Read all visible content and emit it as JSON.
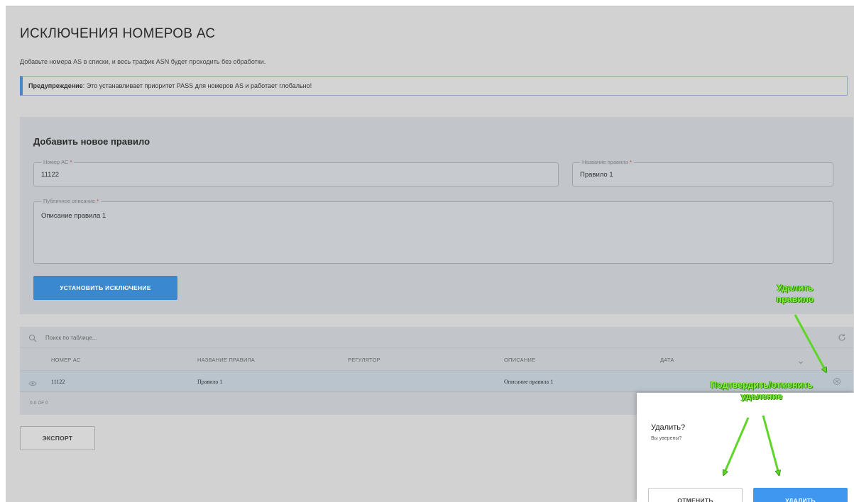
{
  "page": {
    "title": "ИСКЛЮЧЕНИЯ НОМЕРОВ АС",
    "subtitle": "Добавьте номера AS в списки, и весь трафик ASN будет проходить без обработки.",
    "warning_label": "Предупреждение",
    "warning_text": ": Это устанавливает приоритет PASS для номеров AS и работает глобально!"
  },
  "form": {
    "title": "Добавить новое правило",
    "as_number": {
      "label": "Номер АС",
      "value": "11122"
    },
    "rule_name": {
      "label": "Название правила",
      "value": "Правило 1"
    },
    "description": {
      "label": "Публичное описание",
      "value": "Описание правила 1"
    },
    "required_mark": "*",
    "submit_label": "УСТАНОВИТЬ ИСКЛЮЧЕНИЕ"
  },
  "table": {
    "search_placeholder": "Поиск по таблице...",
    "columns": [
      "НОМЕР АС",
      "НАЗВАНИЕ ПРАВИЛА",
      "РЕГУЛЯТОР",
      "ОПИСАНИЕ",
      "ДАТА"
    ],
    "rows": [
      {
        "as_number": "11122",
        "rule_name": "Правило 1",
        "regulator": "",
        "description": "Описание правила 1",
        "date": ""
      }
    ],
    "count_text": "0-0 OF 0"
  },
  "export_label": "ЭКСПОРТ",
  "popup": {
    "title": "Удалить?",
    "text": "Вы уверены?",
    "cancel_label": "ОТМЕНИТЬ",
    "confirm_label": "УДАЛИТЬ"
  },
  "annotations": {
    "delete_rule": "Удалить правило",
    "confirm_cancel_line1": "Подтвердить/отменить",
    "confirm_cancel_line2": "удаление"
  },
  "colors": {
    "primary": "#3a88cf",
    "confirm": "#3f97f0",
    "annotation": "#7cf23a",
    "required": "#c0392b"
  },
  "icons": [
    "search-icon",
    "refresh-icon",
    "eye-icon",
    "delete-icon",
    "sort-icon"
  ]
}
